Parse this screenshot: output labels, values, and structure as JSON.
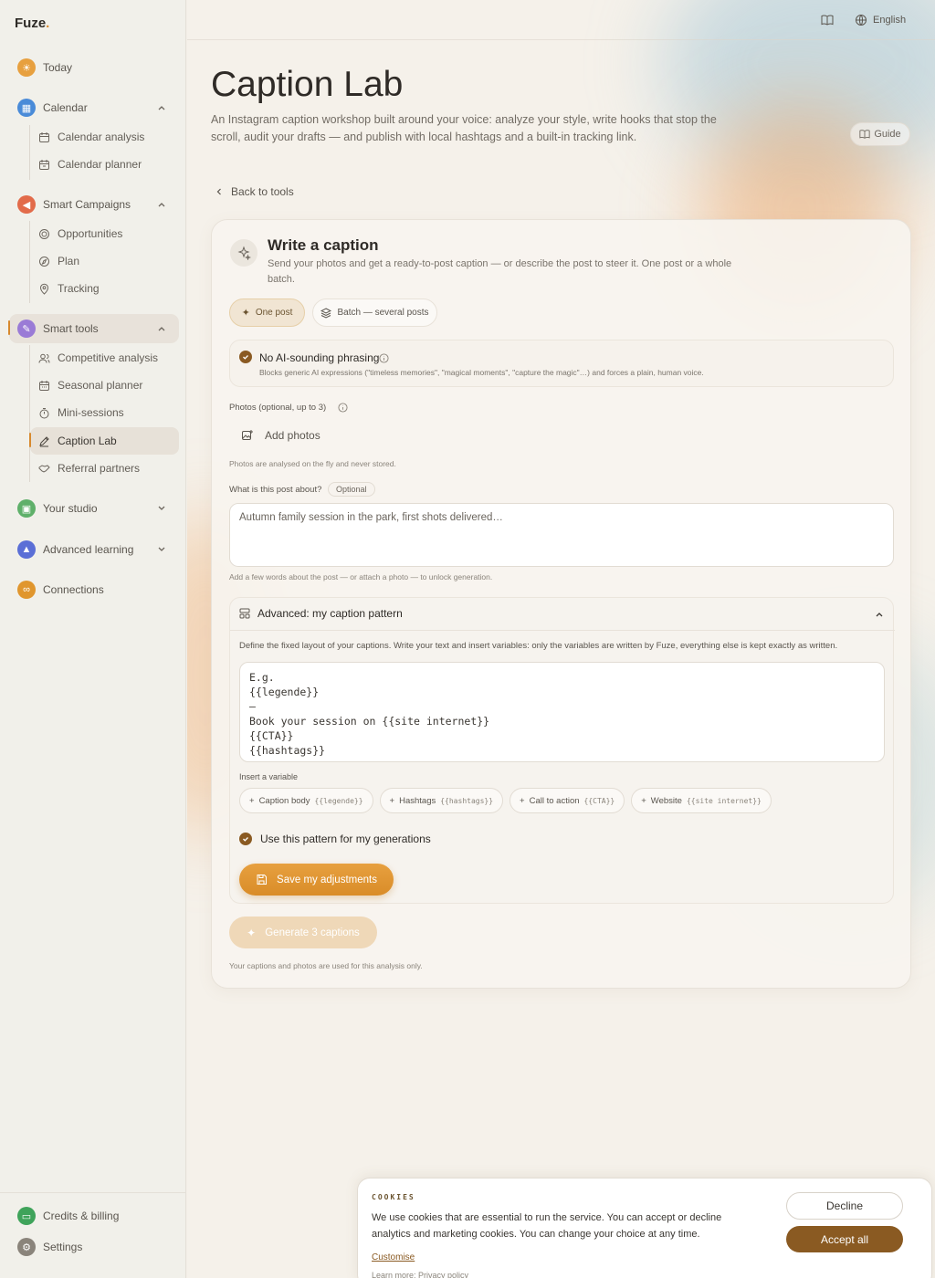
{
  "brand": {
    "name": "Fuze",
    "dot": "."
  },
  "sidebar": {
    "today": "Today",
    "calendar": "Calendar",
    "calendar_items": [
      "Calendar analysis",
      "Calendar planner"
    ],
    "campaigns": "Smart Campaigns",
    "campaign_items": [
      "Opportunities",
      "Plan",
      "Tracking"
    ],
    "smart_tools": "Smart tools",
    "tool_items": [
      "Competitive analysis",
      "Seasonal planner",
      "Mini-sessions",
      "Caption Lab",
      "Referral partners"
    ],
    "studio": "Your studio",
    "learning": "Advanced learning",
    "connections": "Connections",
    "billing": "Credits & billing",
    "settings": "Settings"
  },
  "topbar": {
    "language": "English"
  },
  "page": {
    "title": "Caption Lab",
    "subtitle": "An Instagram caption workshop built around your voice: analyze your style, write hooks that stop the scroll, audit your drafts — and publish with local hashtags and a built-in tracking link.",
    "guide": "Guide",
    "back": "Back to tools"
  },
  "card": {
    "title": "Write a caption",
    "desc": "Send your photos and get a ready-to-post caption — or describe the post to steer it. One post or a whole batch.",
    "mode_one": "One post",
    "mode_batch": "Batch — several posts",
    "nofake_title": "No AI-sounding phrasing",
    "nofake_desc": "Blocks generic AI expressions (\"timeless memories\", \"magical moments\", \"capture the magic\"…) and forces a plain, human voice.",
    "photos_label": "Photos (optional, up to 3)",
    "add_photos": "Add photos",
    "photos_hint": "Photos are analysed on the fly and never stored.",
    "about_label": "What is this post about?",
    "optional": "Optional",
    "about_placeholder": "Autumn family session in the park, first shots delivered…",
    "about_hint": "Add a few words about the post — or attach a photo — to unlock generation.",
    "adv_title": "Advanced: my caption pattern",
    "adv_desc": "Define the fixed layout of your captions. Write your text and insert variables: only the variables are written by Fuze, everything else is kept exactly as written.",
    "pattern": "E.g.\n{{legende}}\n—\nBook your session on {{site internet}}\n{{CTA}}\n{{hashtags}}",
    "insert_label": "Insert a variable",
    "vars": [
      {
        "label": "Caption body",
        "code": "{{legende}}"
      },
      {
        "label": "Hashtags",
        "code": "{{hashtags}}"
      },
      {
        "label": "Call to action",
        "code": "{{CTA}}"
      },
      {
        "label": "Website",
        "code": "{{site internet}}"
      }
    ],
    "use_pattern": "Use this pattern for my generations",
    "save": "Save my adjustments",
    "generate": "Generate 3 captions",
    "footer_hint": "Your captions and photos are used for this analysis only."
  },
  "cookies": {
    "title": "COOKIES",
    "text": "We use cookies that are essential to run the service. You can accept or decline analytics and marketing cookies. You can change your choice at any time.",
    "customise": "Customise",
    "more": "Learn more: Privacy policy",
    "decline": "Decline",
    "accept": "Accept all"
  },
  "colors": {
    "accent": "#d98c28",
    "brown": "#8a5a22"
  }
}
